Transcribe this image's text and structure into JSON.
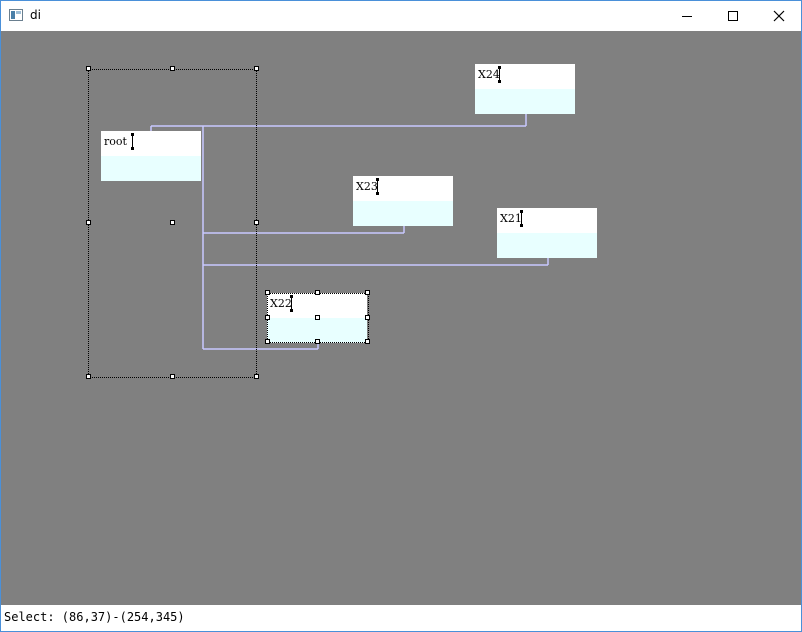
{
  "window": {
    "title": "di"
  },
  "title_controls": [
    "minimize-icon",
    "maximize-icon",
    "close-icon"
  ],
  "nodes": {
    "root": "root",
    "x24": "X24",
    "x23": "X23",
    "x21": "X21",
    "x22": "X22"
  },
  "colors": {
    "canvas": "#808080",
    "node_top": "#ffffff",
    "node_bottom": "#e8ffff",
    "connector": "#c8c8ff"
  },
  "status": "Select: (86,37)-(254,345)"
}
